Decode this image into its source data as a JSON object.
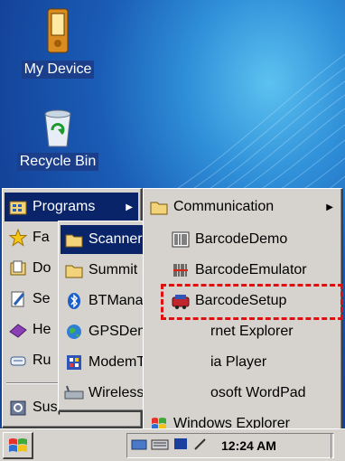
{
  "desktop": {
    "icons": [
      {
        "label": "My Device",
        "icon": "pda-icon"
      },
      {
        "label": "Recycle Bin",
        "icon": "recycle-bin-icon"
      }
    ]
  },
  "start_menu": {
    "items": [
      {
        "label": "Programs",
        "icon": "programs-folder-icon",
        "submenu": true,
        "highlighted": true
      },
      {
        "label": "Fa",
        "icon": "favorites-star-icon"
      },
      {
        "label": "Do",
        "icon": "documents-icon"
      },
      {
        "label": "Se",
        "icon": "settings-icon"
      },
      {
        "label": "He",
        "icon": "help-icon"
      },
      {
        "label": "Ru",
        "icon": "run-icon"
      },
      {
        "label": "Suspend",
        "icon": "suspend-icon"
      }
    ]
  },
  "programs_menu": {
    "items": [
      {
        "label": "Scanner",
        "icon": "folder-icon",
        "highlighted": true
      },
      {
        "label": "Summit",
        "icon": "folder-icon"
      },
      {
        "label": "BTManag",
        "icon": "bluetooth-icon"
      },
      {
        "label": "GPSDemo",
        "icon": "globe-icon"
      },
      {
        "label": "ModemTest",
        "icon": "modem-icon"
      },
      {
        "label": "WirelessLAN",
        "icon": "wlan-icon"
      }
    ]
  },
  "scanner_menu": {
    "items": [
      {
        "label": "Communication",
        "icon": "folder-icon",
        "submenu": true
      },
      {
        "label": "BarcodeDemo",
        "icon": "barcode-icon"
      },
      {
        "label": "BarcodeEmulator",
        "icon": "barcode-emulator-icon"
      },
      {
        "label": "BarcodeSetup",
        "icon": "barcode-setup-icon",
        "annotated": true
      },
      {
        "label": "rnet Explorer",
        "icon": ""
      },
      {
        "label": "ia Player",
        "icon": ""
      },
      {
        "label": "osoft WordPad",
        "icon": ""
      },
      {
        "label": "Windows Explorer",
        "icon": "windows-explorer-icon"
      }
    ]
  },
  "taskbar": {
    "start_icon": "windows-flag-icon",
    "clock": "12:24 AM"
  },
  "colors": {
    "menu_bg": "#d6d3ce",
    "highlight": "#0a246a",
    "annotation": "#e01010"
  }
}
